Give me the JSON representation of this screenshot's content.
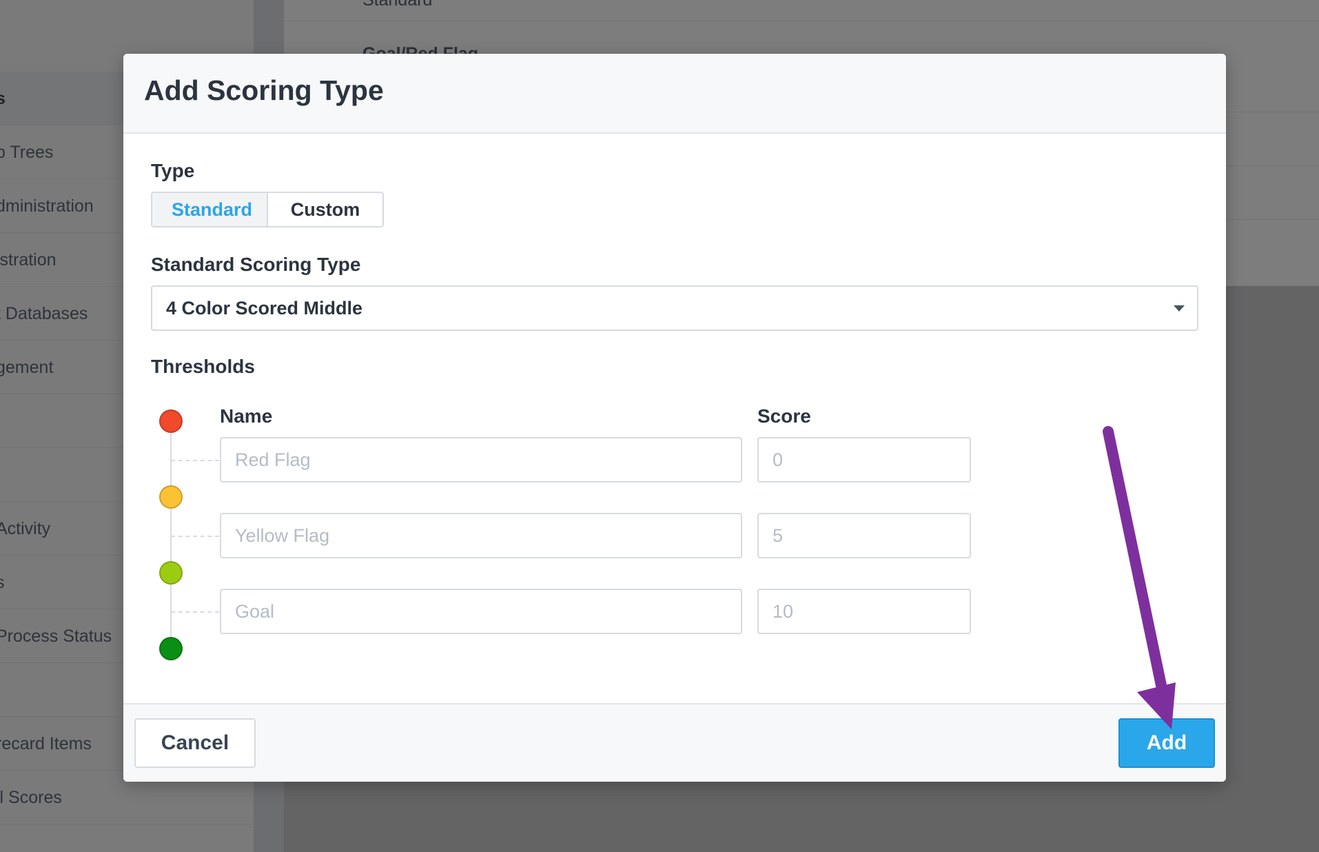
{
  "background": {
    "sidebar_items": [
      {
        "label": "s",
        "active": true
      },
      {
        "label": "p Trees"
      },
      {
        "label": "dministration"
      },
      {
        "label": "istration"
      },
      {
        "label": "t Databases"
      },
      {
        "label": "gement"
      },
      {
        "label": ""
      },
      {
        "label": ""
      },
      {
        "label": "Activity"
      },
      {
        "label": "s"
      },
      {
        "label": "Process Status"
      },
      {
        "label": ""
      },
      {
        "label": "recard Items"
      },
      {
        "label": "ll Scores"
      }
    ],
    "content_rows": [
      "Standard",
      "Goal/Red Flag"
    ]
  },
  "modal": {
    "title": "Add Scoring Type",
    "type_label": "Type",
    "type_options": {
      "standard": "Standard",
      "custom": "Custom",
      "selected": "Standard"
    },
    "scoring_type_label": "Standard Scoring Type",
    "scoring_type_value": "4 Color Scored Middle",
    "thresholds_label": "Thresholds",
    "columns": {
      "name": "Name",
      "score": "Score"
    },
    "thresholds": [
      {
        "name_placeholder": "Red Flag",
        "score_placeholder": "0"
      },
      {
        "name_placeholder": "Yellow Flag",
        "score_placeholder": "5"
      },
      {
        "name_placeholder": "Goal",
        "score_placeholder": "10"
      }
    ],
    "threshold_colors": [
      "#f0492b",
      "#fbc234",
      "#9ccc11",
      "#0a8f15"
    ],
    "cancel_label": "Cancel",
    "add_label": "Add"
  },
  "annotation": {
    "arrow_color": "#7e2f9e"
  },
  "colors": {
    "accent": "#2aa7ea",
    "text": "#2c3440"
  }
}
